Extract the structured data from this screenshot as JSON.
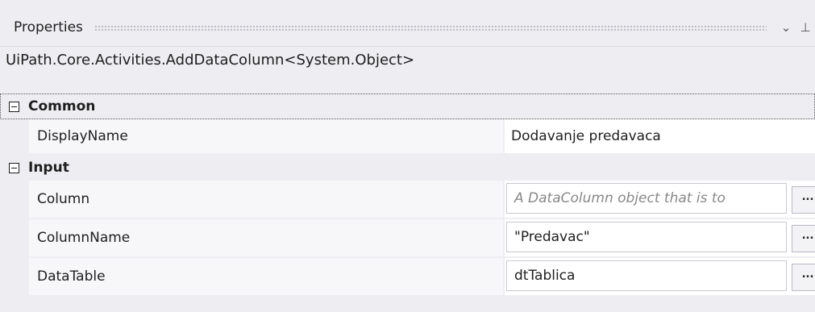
{
  "panel": {
    "title": "Properties",
    "dropdown_glyph": "⌄",
    "pin_glyph": "⊥",
    "type_name": "UiPath.Core.Activities.AddDataColumn<System.Object>"
  },
  "categories": [
    {
      "label": "Common",
      "properties": [
        {
          "name": "DisplayName",
          "value": "Dodavanje predavaca"
        }
      ]
    },
    {
      "label": "Input",
      "properties": [
        {
          "name": "Column",
          "value": "",
          "placeholder": "A DataColumn object that is to",
          "button": "..."
        },
        {
          "name": "ColumnName",
          "value": "\"Predavac\"",
          "button": "..."
        },
        {
          "name": "DataTable",
          "value": "dtTablica",
          "button": "..."
        }
      ]
    }
  ],
  "icons": {
    "expander": "collapse-icon",
    "dropdown": "chevron-down-icon",
    "pin": "pin-icon"
  }
}
